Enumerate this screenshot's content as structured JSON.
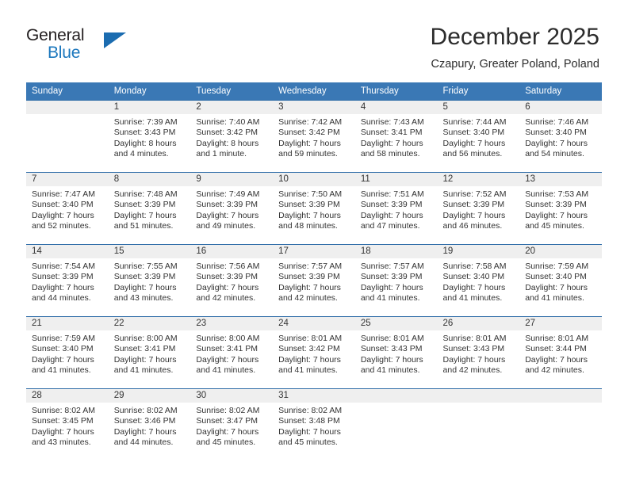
{
  "brand": {
    "name_top": "General",
    "name_bottom": "Blue",
    "accent_color": "#1b6cb0"
  },
  "header": {
    "month_title": "December 2025",
    "location": "Czapury, Greater Poland, Poland"
  },
  "colors": {
    "header_blue": "#3a78b5",
    "grid_line": "#2f6da8",
    "daynum_band": "#efefef",
    "text": "#333333"
  },
  "weekday_headers": [
    "Sunday",
    "Monday",
    "Tuesday",
    "Wednesday",
    "Thursday",
    "Friday",
    "Saturday"
  ],
  "weeks": [
    [
      {
        "day": "",
        "sunrise": "",
        "sunset": "",
        "daylight_line1": "",
        "daylight_line2": ""
      },
      {
        "day": "1",
        "sunrise": "Sunrise: 7:39 AM",
        "sunset": "Sunset: 3:43 PM",
        "daylight_line1": "Daylight: 8 hours",
        "daylight_line2": "and 4 minutes."
      },
      {
        "day": "2",
        "sunrise": "Sunrise: 7:40 AM",
        "sunset": "Sunset: 3:42 PM",
        "daylight_line1": "Daylight: 8 hours",
        "daylight_line2": "and 1 minute."
      },
      {
        "day": "3",
        "sunrise": "Sunrise: 7:42 AM",
        "sunset": "Sunset: 3:42 PM",
        "daylight_line1": "Daylight: 7 hours",
        "daylight_line2": "and 59 minutes."
      },
      {
        "day": "4",
        "sunrise": "Sunrise: 7:43 AM",
        "sunset": "Sunset: 3:41 PM",
        "daylight_line1": "Daylight: 7 hours",
        "daylight_line2": "and 58 minutes."
      },
      {
        "day": "5",
        "sunrise": "Sunrise: 7:44 AM",
        "sunset": "Sunset: 3:40 PM",
        "daylight_line1": "Daylight: 7 hours",
        "daylight_line2": "and 56 minutes."
      },
      {
        "day": "6",
        "sunrise": "Sunrise: 7:46 AM",
        "sunset": "Sunset: 3:40 PM",
        "daylight_line1": "Daylight: 7 hours",
        "daylight_line2": "and 54 minutes."
      }
    ],
    [
      {
        "day": "7",
        "sunrise": "Sunrise: 7:47 AM",
        "sunset": "Sunset: 3:40 PM",
        "daylight_line1": "Daylight: 7 hours",
        "daylight_line2": "and 52 minutes."
      },
      {
        "day": "8",
        "sunrise": "Sunrise: 7:48 AM",
        "sunset": "Sunset: 3:39 PM",
        "daylight_line1": "Daylight: 7 hours",
        "daylight_line2": "and 51 minutes."
      },
      {
        "day": "9",
        "sunrise": "Sunrise: 7:49 AM",
        "sunset": "Sunset: 3:39 PM",
        "daylight_line1": "Daylight: 7 hours",
        "daylight_line2": "and 49 minutes."
      },
      {
        "day": "10",
        "sunrise": "Sunrise: 7:50 AM",
        "sunset": "Sunset: 3:39 PM",
        "daylight_line1": "Daylight: 7 hours",
        "daylight_line2": "and 48 minutes."
      },
      {
        "day": "11",
        "sunrise": "Sunrise: 7:51 AM",
        "sunset": "Sunset: 3:39 PM",
        "daylight_line1": "Daylight: 7 hours",
        "daylight_line2": "and 47 minutes."
      },
      {
        "day": "12",
        "sunrise": "Sunrise: 7:52 AM",
        "sunset": "Sunset: 3:39 PM",
        "daylight_line1": "Daylight: 7 hours",
        "daylight_line2": "and 46 minutes."
      },
      {
        "day": "13",
        "sunrise": "Sunrise: 7:53 AM",
        "sunset": "Sunset: 3:39 PM",
        "daylight_line1": "Daylight: 7 hours",
        "daylight_line2": "and 45 minutes."
      }
    ],
    [
      {
        "day": "14",
        "sunrise": "Sunrise: 7:54 AM",
        "sunset": "Sunset: 3:39 PM",
        "daylight_line1": "Daylight: 7 hours",
        "daylight_line2": "and 44 minutes."
      },
      {
        "day": "15",
        "sunrise": "Sunrise: 7:55 AM",
        "sunset": "Sunset: 3:39 PM",
        "daylight_line1": "Daylight: 7 hours",
        "daylight_line2": "and 43 minutes."
      },
      {
        "day": "16",
        "sunrise": "Sunrise: 7:56 AM",
        "sunset": "Sunset: 3:39 PM",
        "daylight_line1": "Daylight: 7 hours",
        "daylight_line2": "and 42 minutes."
      },
      {
        "day": "17",
        "sunrise": "Sunrise: 7:57 AM",
        "sunset": "Sunset: 3:39 PM",
        "daylight_line1": "Daylight: 7 hours",
        "daylight_line2": "and 42 minutes."
      },
      {
        "day": "18",
        "sunrise": "Sunrise: 7:57 AM",
        "sunset": "Sunset: 3:39 PM",
        "daylight_line1": "Daylight: 7 hours",
        "daylight_line2": "and 41 minutes."
      },
      {
        "day": "19",
        "sunrise": "Sunrise: 7:58 AM",
        "sunset": "Sunset: 3:40 PM",
        "daylight_line1": "Daylight: 7 hours",
        "daylight_line2": "and 41 minutes."
      },
      {
        "day": "20",
        "sunrise": "Sunrise: 7:59 AM",
        "sunset": "Sunset: 3:40 PM",
        "daylight_line1": "Daylight: 7 hours",
        "daylight_line2": "and 41 minutes."
      }
    ],
    [
      {
        "day": "21",
        "sunrise": "Sunrise: 7:59 AM",
        "sunset": "Sunset: 3:40 PM",
        "daylight_line1": "Daylight: 7 hours",
        "daylight_line2": "and 41 minutes."
      },
      {
        "day": "22",
        "sunrise": "Sunrise: 8:00 AM",
        "sunset": "Sunset: 3:41 PM",
        "daylight_line1": "Daylight: 7 hours",
        "daylight_line2": "and 41 minutes."
      },
      {
        "day": "23",
        "sunrise": "Sunrise: 8:00 AM",
        "sunset": "Sunset: 3:41 PM",
        "daylight_line1": "Daylight: 7 hours",
        "daylight_line2": "and 41 minutes."
      },
      {
        "day": "24",
        "sunrise": "Sunrise: 8:01 AM",
        "sunset": "Sunset: 3:42 PM",
        "daylight_line1": "Daylight: 7 hours",
        "daylight_line2": "and 41 minutes."
      },
      {
        "day": "25",
        "sunrise": "Sunrise: 8:01 AM",
        "sunset": "Sunset: 3:43 PM",
        "daylight_line1": "Daylight: 7 hours",
        "daylight_line2": "and 41 minutes."
      },
      {
        "day": "26",
        "sunrise": "Sunrise: 8:01 AM",
        "sunset": "Sunset: 3:43 PM",
        "daylight_line1": "Daylight: 7 hours",
        "daylight_line2": "and 42 minutes."
      },
      {
        "day": "27",
        "sunrise": "Sunrise: 8:01 AM",
        "sunset": "Sunset: 3:44 PM",
        "daylight_line1": "Daylight: 7 hours",
        "daylight_line2": "and 42 minutes."
      }
    ],
    [
      {
        "day": "28",
        "sunrise": "Sunrise: 8:02 AM",
        "sunset": "Sunset: 3:45 PM",
        "daylight_line1": "Daylight: 7 hours",
        "daylight_line2": "and 43 minutes."
      },
      {
        "day": "29",
        "sunrise": "Sunrise: 8:02 AM",
        "sunset": "Sunset: 3:46 PM",
        "daylight_line1": "Daylight: 7 hours",
        "daylight_line2": "and 44 minutes."
      },
      {
        "day": "30",
        "sunrise": "Sunrise: 8:02 AM",
        "sunset": "Sunset: 3:47 PM",
        "daylight_line1": "Daylight: 7 hours",
        "daylight_line2": "and 45 minutes."
      },
      {
        "day": "31",
        "sunrise": "Sunrise: 8:02 AM",
        "sunset": "Sunset: 3:48 PM",
        "daylight_line1": "Daylight: 7 hours",
        "daylight_line2": "and 45 minutes."
      },
      {
        "day": "",
        "sunrise": "",
        "sunset": "",
        "daylight_line1": "",
        "daylight_line2": ""
      },
      {
        "day": "",
        "sunrise": "",
        "sunset": "",
        "daylight_line1": "",
        "daylight_line2": ""
      },
      {
        "day": "",
        "sunrise": "",
        "sunset": "",
        "daylight_line1": "",
        "daylight_line2": ""
      }
    ]
  ]
}
